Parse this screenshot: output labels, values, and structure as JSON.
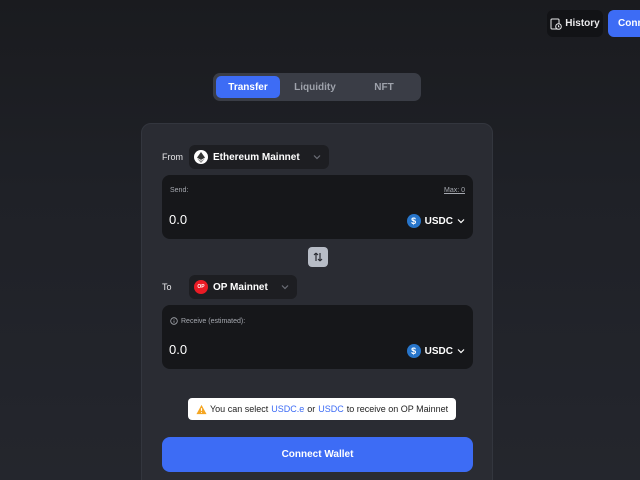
{
  "header": {
    "history_label": "History",
    "connect_label": "Connect Wallet"
  },
  "tabs": [
    {
      "label": "Transfer",
      "active": true
    },
    {
      "label": "Liquidity",
      "active": false
    },
    {
      "label": "NFT",
      "active": false
    }
  ],
  "from": {
    "label": "From",
    "chain": "Ethereum Mainnet",
    "send_label": "Send:",
    "max_label": "Max: 0",
    "amount": "0.0",
    "token": "USDC"
  },
  "to": {
    "label": "To",
    "chain": "OP Mainnet",
    "chain_badge": "OP",
    "receive_label": "Receive (estimated):",
    "amount": "0.0",
    "token": "USDC"
  },
  "notice": {
    "prefix": "You can select",
    "link1": "USDC.e",
    "middle": "or",
    "link2": "USDC",
    "suffix": "to receive on OP Mainnet"
  },
  "connect_button": "Connect Wallet",
  "colors": {
    "accent": "#3d6cf5",
    "usdc": "#2775ca",
    "op_red": "#ea1b25",
    "warning": "#f5a623"
  }
}
